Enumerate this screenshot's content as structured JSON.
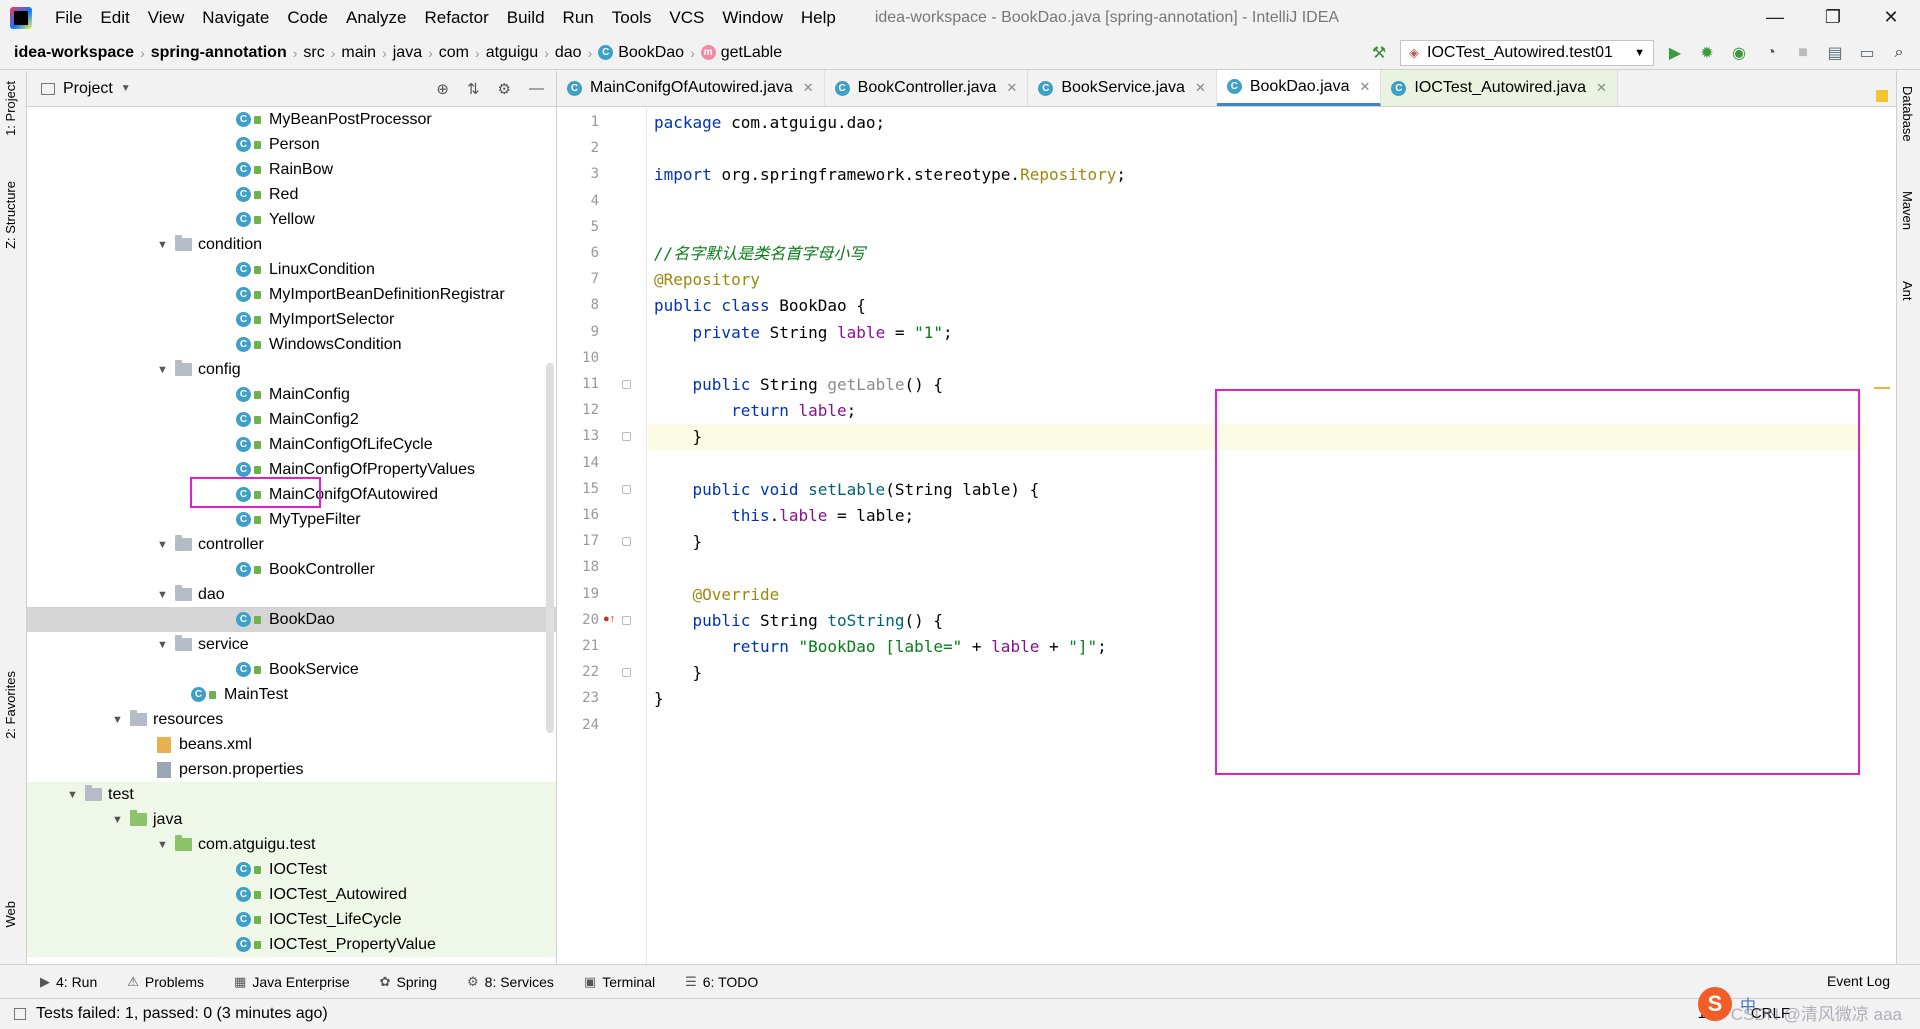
{
  "window": {
    "title": "idea-workspace - BookDao.java [spring-annotation] - IntelliJ IDEA",
    "controls": {
      "minimize": "—",
      "restore": "❐",
      "close": "✕"
    }
  },
  "menu": {
    "items": [
      "File",
      "Edit",
      "View",
      "Navigate",
      "Code",
      "Analyze",
      "Refactor",
      "Build",
      "Run",
      "Tools",
      "VCS",
      "Window",
      "Help"
    ]
  },
  "breadcrumb": {
    "items": [
      "idea-workspace",
      "spring-annotation",
      "src",
      "main",
      "java",
      "com",
      "atguigu",
      "dao",
      "BookDao",
      "getLable"
    ]
  },
  "run_config": {
    "label": "IOCTest_Autowired.test01"
  },
  "project_panel": {
    "title": "Project",
    "tree": [
      {
        "label": "MyBeanPostProcessor",
        "indent": 4,
        "kind": "class"
      },
      {
        "label": "Person",
        "indent": 4,
        "kind": "class"
      },
      {
        "label": "RainBow",
        "indent": 4,
        "kind": "class"
      },
      {
        "label": "Red",
        "indent": 4,
        "kind": "class"
      },
      {
        "label": "Yellow",
        "indent": 4,
        "kind": "class"
      },
      {
        "label": "condition",
        "indent": 3,
        "kind": "package"
      },
      {
        "label": "LinuxCondition",
        "indent": 4,
        "kind": "class"
      },
      {
        "label": "MyImportBeanDefinitionRegistrar",
        "indent": 4,
        "kind": "class"
      },
      {
        "label": "MyImportSelector",
        "indent": 4,
        "kind": "class"
      },
      {
        "label": "WindowsCondition",
        "indent": 4,
        "kind": "class"
      },
      {
        "label": "config",
        "indent": 3,
        "kind": "package"
      },
      {
        "label": "MainConfig",
        "indent": 4,
        "kind": "class"
      },
      {
        "label": "MainConfig2",
        "indent": 4,
        "kind": "class"
      },
      {
        "label": "MainConfigOfLifeCycle",
        "indent": 4,
        "kind": "class"
      },
      {
        "label": "MainConfigOfPropertyValues",
        "indent": 4,
        "kind": "class"
      },
      {
        "label": "MainConifgOfAutowired",
        "indent": 4,
        "kind": "class"
      },
      {
        "label": "MyTypeFilter",
        "indent": 4,
        "kind": "class"
      },
      {
        "label": "controller",
        "indent": 3,
        "kind": "package"
      },
      {
        "label": "BookController",
        "indent": 4,
        "kind": "class"
      },
      {
        "label": "dao",
        "indent": 3,
        "kind": "package"
      },
      {
        "label": "BookDao",
        "indent": 4,
        "kind": "class",
        "selected": true
      },
      {
        "label": "service",
        "indent": 3,
        "kind": "package"
      },
      {
        "label": "BookService",
        "indent": 4,
        "kind": "class"
      },
      {
        "label": "MainTest",
        "indent": 3,
        "kind": "main"
      },
      {
        "label": "resources",
        "indent": 2,
        "kind": "folder"
      },
      {
        "label": "beans.xml",
        "indent": 3,
        "kind": "xml"
      },
      {
        "label": "person.properties",
        "indent": 3,
        "kind": "prop"
      },
      {
        "label": "test",
        "indent": 1,
        "kind": "folder"
      },
      {
        "label": "java",
        "indent": 2,
        "kind": "test-folder"
      },
      {
        "label": "com.atguigu.test",
        "indent": 3,
        "kind": "test-package"
      },
      {
        "label": "IOCTest",
        "indent": 4,
        "kind": "test-class"
      },
      {
        "label": "IOCTest_Autowired",
        "indent": 4,
        "kind": "test-class"
      },
      {
        "label": "IOCTest_LifeCycle",
        "indent": 4,
        "kind": "test-class"
      },
      {
        "label": "IOCTest_PropertyValue",
        "indent": 4,
        "kind": "test-class"
      }
    ]
  },
  "editor_tabs": [
    {
      "label": "MainConifgOfAutowired.java",
      "active": false,
      "test": false
    },
    {
      "label": "BookController.java",
      "active": false,
      "test": false
    },
    {
      "label": "BookService.java",
      "active": false,
      "test": false
    },
    {
      "label": "BookDao.java",
      "active": true,
      "test": false
    },
    {
      "label": "IOCTest_Autowired.java",
      "active": false,
      "test": true
    }
  ],
  "code_lines": [
    [
      [
        "kw",
        "package "
      ],
      [
        "",
        "com.atguigu.dao;"
      ]
    ],
    [],
    [
      [
        "kw",
        "import "
      ],
      [
        "",
        "org.springframework.stereotype."
      ],
      [
        "ann",
        "Repository"
      ],
      [
        "",
        ";"
      ]
    ],
    [],
    [],
    [
      [
        "cmt-green",
        "//名字默认是类名首字母小写"
      ]
    ],
    [
      [
        "ann",
        "@Repository"
      ]
    ],
    [
      [
        "kw",
        "public class "
      ],
      [
        "",
        "BookDao {"
      ]
    ],
    [
      [
        "",
        "    "
      ],
      [
        "kw",
        "private "
      ],
      [
        "",
        "String "
      ],
      [
        "fld",
        "lable"
      ],
      [
        "",
        " = "
      ],
      [
        "str",
        "\"1\""
      ],
      [
        "",
        ";"
      ]
    ],
    [],
    [
      [
        "",
        "    "
      ],
      [
        "kw",
        "public "
      ],
      [
        "",
        "String "
      ],
      [
        "grey",
        "getLable"
      ],
      [
        "",
        "() {"
      ]
    ],
    [
      [
        "",
        "        "
      ],
      [
        "kw",
        "return "
      ],
      [
        "fld",
        "lable"
      ],
      [
        "",
        ";"
      ]
    ],
    [
      [
        "",
        "    }"
      ]
    ],
    [],
    [
      [
        "",
        "    "
      ],
      [
        "kw",
        "public void "
      ],
      [
        "mth",
        "setLable"
      ],
      [
        "",
        "(String lable) {"
      ]
    ],
    [
      [
        "",
        "        "
      ],
      [
        "kw",
        "this"
      ],
      [
        "",
        "."
      ],
      [
        "fld",
        "lable"
      ],
      [
        "",
        " = lable;"
      ]
    ],
    [
      [
        "",
        "    }"
      ]
    ],
    [],
    [
      [
        "",
        "    "
      ],
      [
        "ann",
        "@Override"
      ]
    ],
    [
      [
        "",
        "    "
      ],
      [
        "kw",
        "public "
      ],
      [
        "",
        "String "
      ],
      [
        "mth",
        "toString"
      ],
      [
        "",
        "() {"
      ]
    ],
    [
      [
        "",
        "        "
      ],
      [
        "kw",
        "return "
      ],
      [
        "str",
        "\"BookDao [lable=\""
      ],
      [
        "",
        " + "
      ],
      [
        "fld",
        "lable"
      ],
      [
        "",
        " + "
      ],
      [
        "str",
        "\"]\""
      ],
      [
        "",
        ";"
      ]
    ],
    [
      [
        "",
        "    }"
      ]
    ],
    [
      [
        "",
        "}"
      ]
    ],
    []
  ],
  "current_line": 13,
  "right_stripe": [
    "Database",
    "Maven",
    "Ant"
  ],
  "left_stripe": [
    "1: Project",
    "Z: Structure",
    "2: Favorites",
    "Web"
  ],
  "bottom_tools": [
    {
      "glyph": "▶",
      "label": "4: Run"
    },
    {
      "glyph": "⚠",
      "label": "Problems"
    },
    {
      "glyph": "▦",
      "label": "Java Enterprise"
    },
    {
      "glyph": "✿",
      "label": "Spring"
    },
    {
      "glyph": "⚙",
      "label": "8: Services"
    },
    {
      "glyph": "▣",
      "label": "Terminal"
    },
    {
      "glyph": "☰",
      "label": "6: TODO"
    }
  ],
  "event_log": "Event Log",
  "status": {
    "message": "Tests failed: 1, passed: 0 (3 minutes ago)",
    "position": "13:6",
    "line_sep": "CRLF"
  },
  "ime": {
    "logo": "S",
    "lang": "中"
  },
  "watermark": "CSDN @清风微凉 aaa"
}
